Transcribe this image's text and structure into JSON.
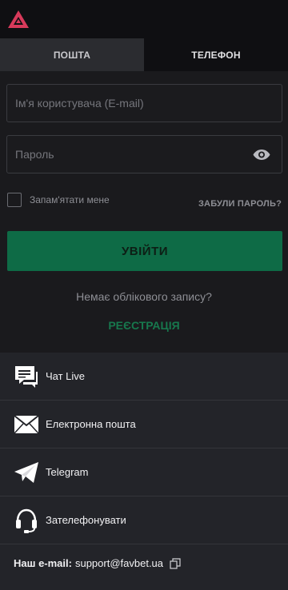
{
  "header": {
    "logo": "favbet-logo"
  },
  "tabs": [
    {
      "label": "ПОШТА",
      "active": true
    },
    {
      "label": "ТЕЛЕФОН",
      "active": false
    }
  ],
  "form": {
    "username_placeholder": "Ім'я користувача (E-mail)",
    "username_value": "",
    "password_placeholder": "Пароль",
    "password_value": "",
    "remember_label": "Запам'ятати мене",
    "remember_checked": false,
    "forgot_label": "ЗАБУЛИ ПАРОЛЬ?",
    "login_label": "УВІЙТИ",
    "no_account_text": "Немає облікового запису?",
    "register_label": "РЕЄСТРАЦІЯ"
  },
  "contacts": {
    "items": [
      {
        "label": "Чат Live",
        "icon": "chat-icon"
      },
      {
        "label": "Електронна пошта",
        "icon": "envelope-icon"
      },
      {
        "label": "Telegram",
        "icon": "telegram-icon"
      },
      {
        "label": "Зателефонувати",
        "icon": "headset-icon"
      }
    ],
    "email_label": "Наш e-mail:",
    "email_value": "support@favbet.ua"
  },
  "colors": {
    "accent": "#0e6b46",
    "register_text": "#17784d",
    "logo": "#d83a5b",
    "background": "#1a1a1d",
    "contacts_background": "#232429"
  }
}
